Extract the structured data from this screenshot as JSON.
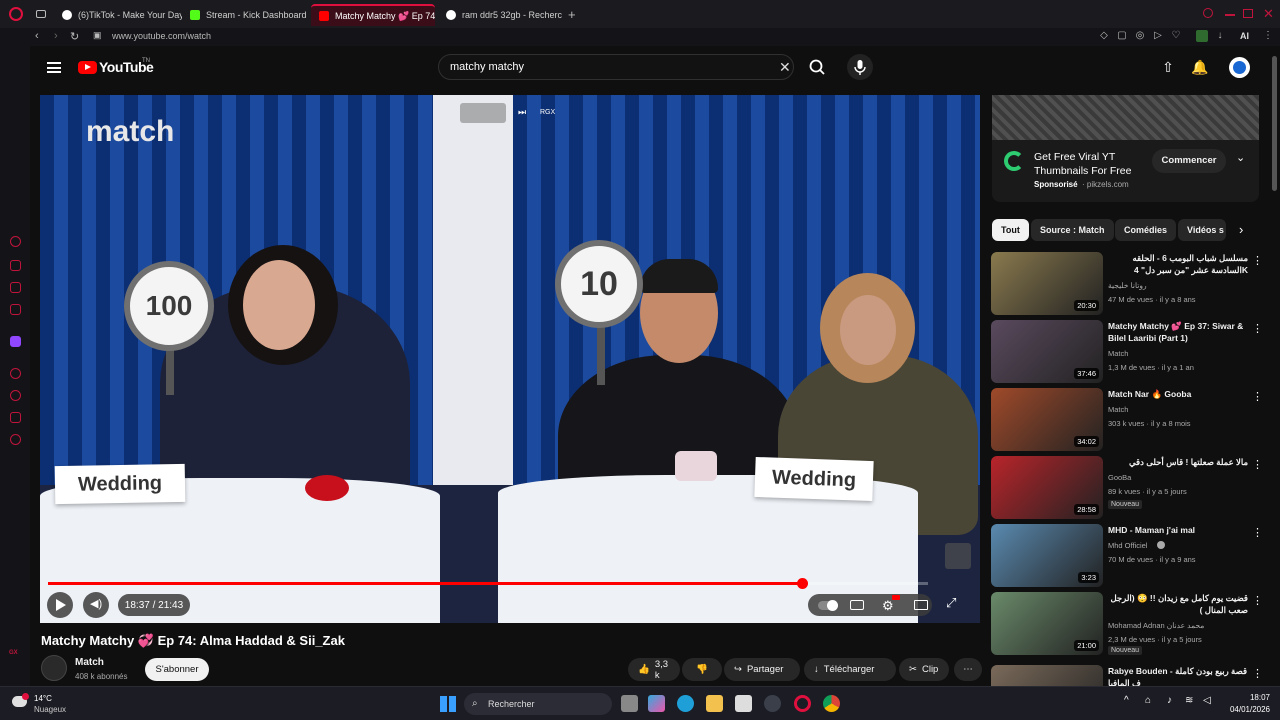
{
  "browser": {
    "tabs": [
      {
        "label": "(6)TikTok - Make Your Day",
        "fav_color": "#ffffff"
      },
      {
        "label": "Stream - Kick Dashboard",
        "fav_color": "#53fc18"
      },
      {
        "label": "Matchy Matchy 💕 Ep 74:",
        "fav_color": "#ff0000",
        "active": true
      },
      {
        "label": "ram ddr5 32gb - Recherch",
        "fav_color": "#ffffff"
      }
    ],
    "address": "www.youtube.com/watch",
    "ai_label": "AI"
  },
  "header": {
    "logo_text": "YouTube",
    "logo_tm": "TN",
    "search_value": "matchy matchy"
  },
  "player": {
    "watermark": "match",
    "overlay_label": "RGX",
    "paddle_left": "100",
    "paddle_right": "10",
    "card_left": "Wedding",
    "card_right": "Wedding",
    "time": "18:37 / 21:43",
    "progress": 0.857
  },
  "video": {
    "title": "Matchy Matchy 💞 Ep 74: Alma Haddad & Sii_Zak",
    "channel": "Match",
    "subscribers": "408 k abonnés",
    "subscribe_label": "S'abonner",
    "likes": "3,3 k",
    "share": "Partager",
    "download": "Télécharger",
    "clip": "Clip"
  },
  "ad": {
    "title_line1": "Get Free Viral YT",
    "title_line2": "Thumbnails For Free",
    "sponsored": "Sponsorisé",
    "domain": "· pikzels.com",
    "cta": "Commencer"
  },
  "chips": [
    "Tout",
    "Source : Match",
    "Comédies",
    "Vidéos s"
  ],
  "recommendations": [
    {
      "title": "مسلسل شباب البومب 6 - الحلقه السادسة عشر \"من سبر دل\" 4K",
      "channel": "روتانا خليجية",
      "meta": "47 M de vues · il y a 8 ans",
      "duration": "20:30",
      "color": "#8a7a4e",
      "new": ""
    },
    {
      "title": "Matchy Matchy 💕 Ep 37: Siwar & Bilel Laaribi (Part 1)",
      "channel": "Match",
      "meta": "1,3 M de vues · il y a 1 an",
      "duration": "37:46",
      "color": "#5a4a5e",
      "new": ""
    },
    {
      "title": "Match Nar 🔥 Gooba",
      "channel": "Match",
      "meta": "303 k vues · il y a 8 mois",
      "duration": "34:02",
      "color": "#a04a2a",
      "new": ""
    },
    {
      "title": "مالا عملة صعلتها ! قاس أحلى دقي",
      "channel": "GooBa",
      "meta": "89 k vues · il y a 5 jours",
      "duration": "28:58",
      "color": "#b8242a",
      "new": "Nouveau"
    },
    {
      "title": "MHD - Maman j'ai mal",
      "channel": "Mhd Officiel",
      "meta": "70 M de vues · il y a 9 ans",
      "duration": "3:23",
      "color": "#5a8ab0",
      "new": ""
    },
    {
      "title": "قضيت يوم كامل مع زيدان !! 😳 (الرجل صعب المنال )",
      "channel": "Mohamad Adnan محمد عدنان",
      "meta": "2,3 M de vues · il y a 5 jours",
      "duration": "21:00",
      "color": "#6a8a6a",
      "new": "Nouveau"
    },
    {
      "title": "Rabye Bouden - قصة ربيع بودن كاملة ف المافيا",
      "channel": "",
      "meta": "",
      "duration": "",
      "color": "#7a6a5a",
      "new": ""
    }
  ],
  "taskbar": {
    "temp": "14°C",
    "weather": "Nuageux",
    "search_placeholder": "Rechercher",
    "time": "18:07",
    "date": "04/01/2026"
  }
}
